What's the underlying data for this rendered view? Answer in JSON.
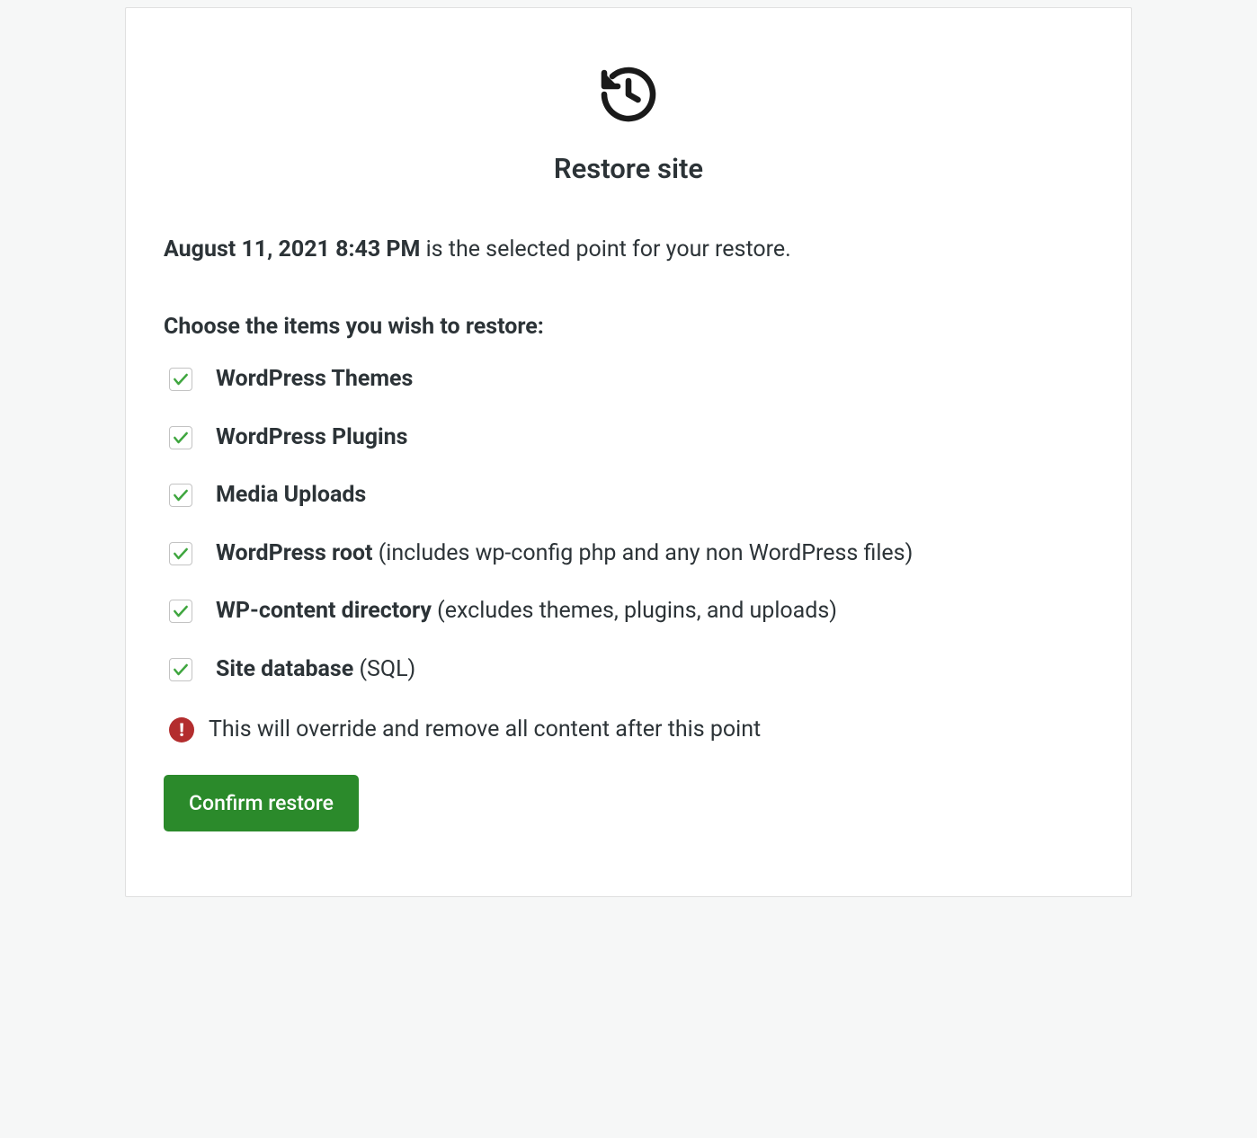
{
  "header": {
    "title": "Restore site"
  },
  "selected_point": {
    "date": "August 11, 2021 8:43 PM",
    "suffix": " is the selected point for your restore."
  },
  "choose_label": "Choose the items you wish to restore:",
  "items": [
    {
      "label": "WordPress Themes",
      "note": ""
    },
    {
      "label": "WordPress Plugins",
      "note": ""
    },
    {
      "label": "Media Uploads",
      "note": ""
    },
    {
      "label": "WordPress root",
      "note": " (includes wp-config php and any non WordPress files)"
    },
    {
      "label": "WP-content directory",
      "note": " (excludes themes, plugins, and uploads)"
    },
    {
      "label": "Site database",
      "note": " (SQL)"
    }
  ],
  "warning": {
    "text": "This will override and remove all content after this point"
  },
  "confirm_button": {
    "label": "Confirm restore"
  },
  "colors": {
    "check": "#3fa63f",
    "warning_bg": "#b32d2e",
    "button_bg": "#2b8a2b"
  }
}
